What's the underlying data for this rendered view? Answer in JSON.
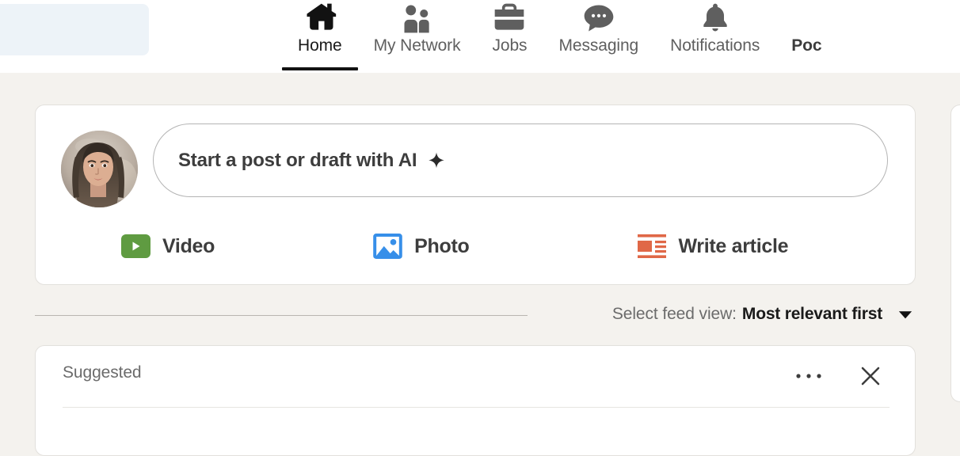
{
  "nav": {
    "search": {
      "placeholder": ""
    },
    "items": [
      {
        "label": "Home",
        "icon": "home-icon",
        "active": true
      },
      {
        "label": "My Network",
        "icon": "people-icon",
        "active": false
      },
      {
        "label": "Jobs",
        "icon": "briefcase-icon",
        "active": false
      },
      {
        "label": "Messaging",
        "icon": "chat-bubble-icon",
        "active": false
      },
      {
        "label": "Notifications",
        "icon": "bell-icon",
        "active": false
      },
      {
        "label": "Poc",
        "icon": "cut-off-icon",
        "active": false
      }
    ]
  },
  "composer": {
    "avatar_name": "user-avatar",
    "placeholder": "Start a post or draft with AI",
    "sparkle_icon": "sparkle-icon",
    "actions": [
      {
        "label": "Video",
        "icon": "video-icon",
        "color": "#5f9b41"
      },
      {
        "label": "Photo",
        "icon": "photo-icon",
        "color": "#378fe9"
      },
      {
        "label": "Write article",
        "icon": "article-icon",
        "color": "#e06847"
      }
    ]
  },
  "feed_sort": {
    "label": "Select feed view:",
    "value": "Most relevant first",
    "chevron_icon": "chevron-down-icon"
  },
  "post": {
    "badge": "Suggested",
    "menu_icon": "more-options-icon",
    "close_icon": "close-icon"
  },
  "colors": {
    "page_background": "#f4f2ee",
    "card_background": "#ffffff",
    "search_background": "#edf3f8",
    "active_underline": "#121212",
    "video_green": "#5f9b41",
    "photo_blue": "#378fe9",
    "article_orange": "#e06847"
  }
}
